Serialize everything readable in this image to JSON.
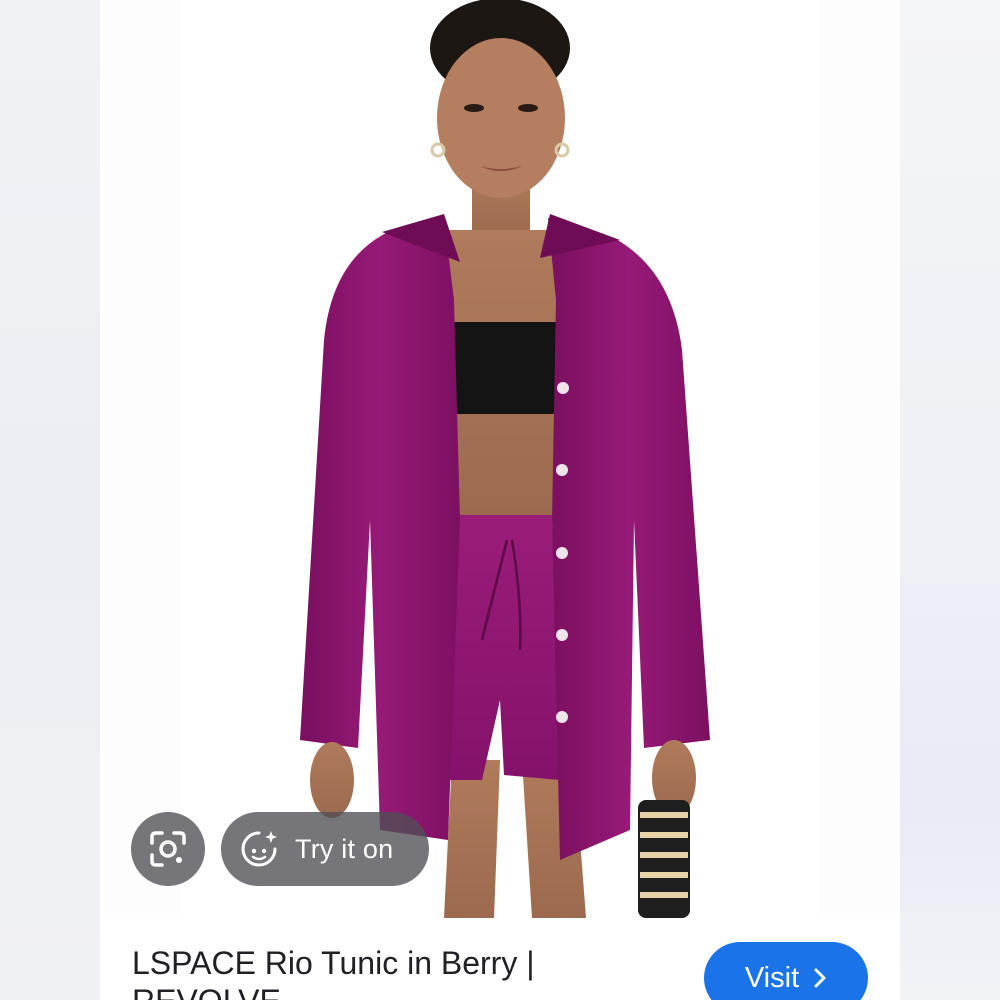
{
  "result": {
    "title": "LSPACE Rio Tunic in Berry | REVOLVE",
    "visit_label": "Visit"
  },
  "overlay": {
    "lens_icon": "lens-camera-icon",
    "tryon_icon": "try-on-sparkle-icon",
    "tryon_label": "Try it on"
  },
  "product": {
    "image_alt": "Model wearing berry linen button-up tunic with matching drawstring shorts",
    "garment_color": "#8e1570",
    "accent_color": "#1a73e8"
  }
}
